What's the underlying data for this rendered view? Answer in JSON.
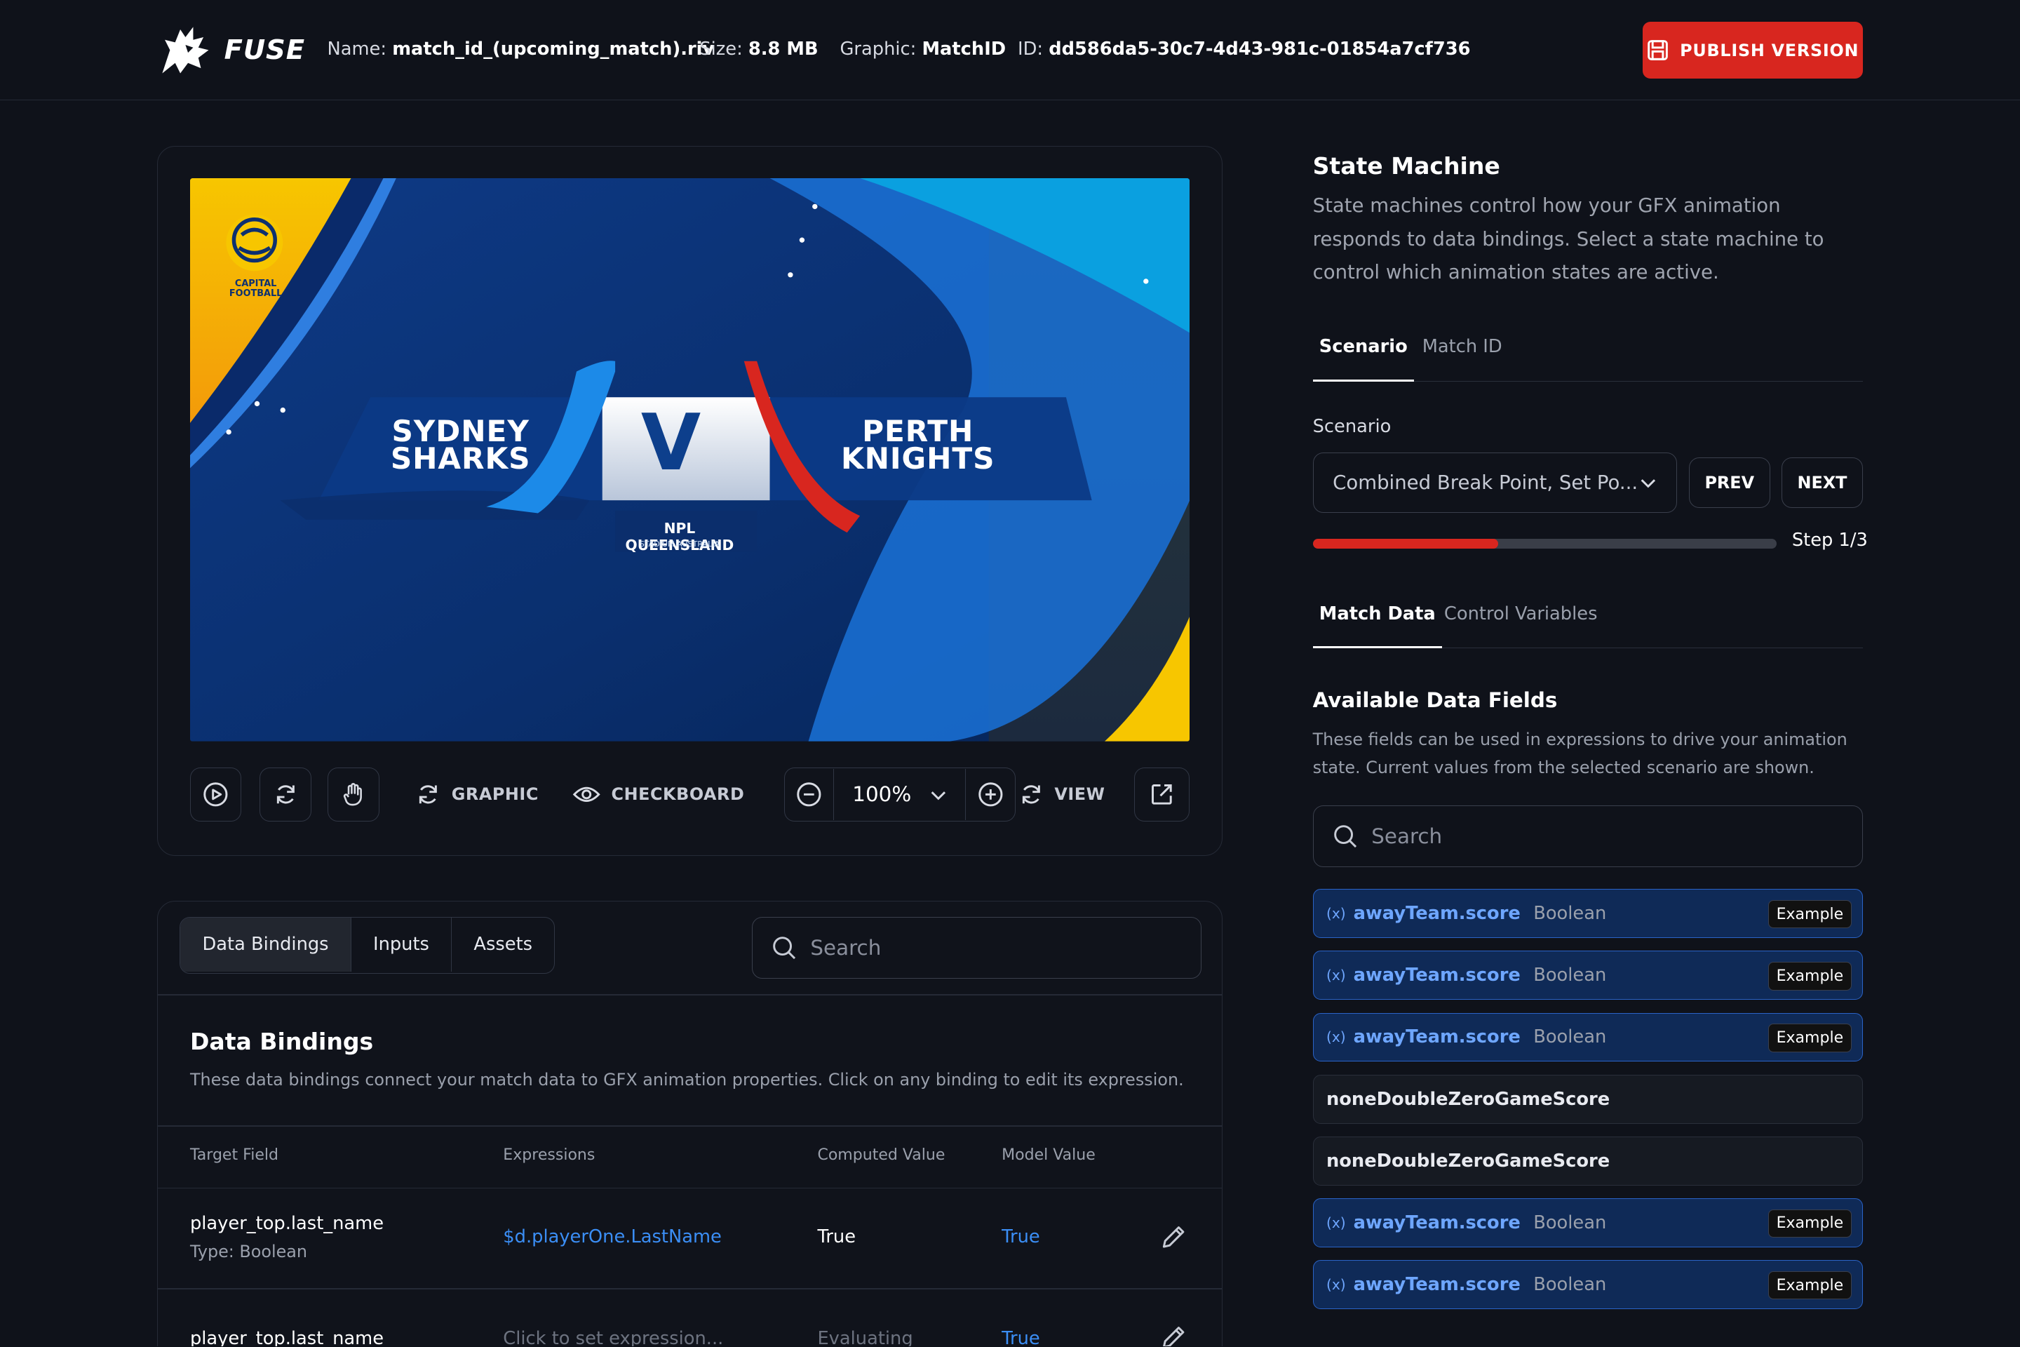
{
  "header": {
    "brand": "FUSE",
    "name_label": "Name:",
    "name_value": "match_id_(upcoming_match).riv",
    "size_label": "Size:",
    "size_value": "8.8 MB",
    "graphic_label": "Graphic:",
    "graphic_value": "MatchID",
    "id_label": "ID:",
    "id_value": "dd586da5-30c7-4d43-981c-01854a7cf736",
    "publish_label": "PUBLISH VERSION"
  },
  "graphic": {
    "club_line1": "CAPITAL",
    "club_line2": "FOOTBALL",
    "team_left_1": "SYDNEY",
    "team_left_2": "SHARKS",
    "versus": "V",
    "team_right_1": "PERTH",
    "team_right_2": "KNIGHTS",
    "league": "NPL QUEENSLAND",
    "stadium": "STADIUM AUSTRALIA"
  },
  "toolbar": {
    "graphic_label": "GRAPHIC",
    "checkboard_label": "CHECKBOARD",
    "zoom_value": "100%",
    "view_label": "VIEW"
  },
  "bindings": {
    "tabs": [
      "Data Bindings",
      "Inputs",
      "Assets"
    ],
    "search_placeholder": "Search",
    "title": "Data Bindings",
    "description": "These data bindings connect your match data to GFX animation properties. Click on any binding to edit its expression.",
    "columns": [
      "Target Field",
      "Expressions",
      "Computed Value",
      "Model Value"
    ],
    "rows": [
      {
        "target": "player_top.last_name",
        "type": "Type: Boolean",
        "expression": "$d.playerOne.LastName",
        "computed": "True",
        "model": "True"
      },
      {
        "target": "player_top.last_name",
        "type": "",
        "expression": "Click to set expression...",
        "computed": "Evaluating",
        "model": "True"
      }
    ]
  },
  "state_machine": {
    "title": "State Machine",
    "description": "State machines control how your GFX animation responds to data bindings. Select a state machine to control which animation states are active.",
    "tabs": [
      "Scenario",
      "Match ID"
    ],
    "scenario_label": "Scenario",
    "scenario_value": "Combined Break Point, Set Po...",
    "prev_label": "PREV",
    "next_label": "NEXT",
    "progress_fraction": 0.4,
    "step_text": "Step 1/3",
    "data_tabs": [
      "Match Data",
      "Control Variables"
    ],
    "fields_title": "Available Data Fields",
    "fields_desc": "These fields can be used in expressions to drive your animation state. Current values from the selected scenario are shown.",
    "search_placeholder": "Search",
    "fields": [
      {
        "name": "awayTeam.score",
        "type": "Boolean",
        "badge": "Example",
        "bound": true
      },
      {
        "name": "awayTeam.score",
        "type": "Boolean",
        "badge": "Example",
        "bound": true
      },
      {
        "name": "awayTeam.score",
        "type": "Boolean",
        "badge": "Example",
        "bound": true
      },
      {
        "name": "noneDoubleZeroGameScore",
        "type": "",
        "badge": "",
        "bound": false
      },
      {
        "name": "noneDoubleZeroGameScore",
        "type": "",
        "badge": "",
        "bound": false
      },
      {
        "name": "awayTeam.score",
        "type": "Boolean",
        "badge": "Example",
        "bound": true
      },
      {
        "name": "awayTeam.score",
        "type": "Boolean",
        "badge": "Example",
        "bound": true
      }
    ],
    "fx_symbol": "(x)"
  },
  "colors": {
    "accent_red": "#d8261f",
    "link_blue": "#3b8ef5",
    "bound_bg": "#0f2a57",
    "bound_border": "#2a63c7"
  }
}
